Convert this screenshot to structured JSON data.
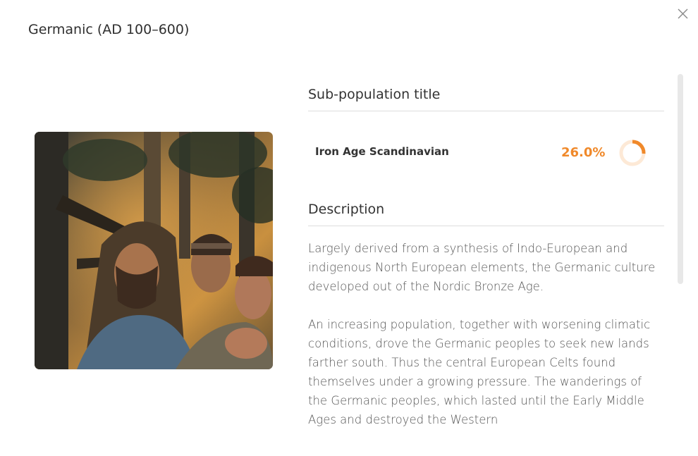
{
  "modal": {
    "title": "Germanic (AD 100–600)"
  },
  "image": {
    "alt": "Painting of three Germanic tribesmen in a forest"
  },
  "sub_population": {
    "heading": "Sub-population title",
    "name": "Iron Age Scandinavian",
    "percent_label": "26.0%",
    "percent_value": 26.0
  },
  "description": {
    "heading": "Description",
    "paragraphs": [
      "Largely derived from a synthesis of Indo-European and indigenous North European elements, the Germanic culture developed out of the Nordic Bronze Age.",
      "An increasing population, together with worsening climatic conditions, drove the Germanic peoples to seek new lands farther south. Thus the central European Celts found themselves under a growing pressure. The wanderings of the Germanic peoples, which lasted until the Early Middle Ages and destroyed the Western"
    ]
  },
  "colors": {
    "accent": "#f0892a",
    "accent_light": "#fde9d6"
  },
  "icons": {
    "close": "close-icon"
  }
}
